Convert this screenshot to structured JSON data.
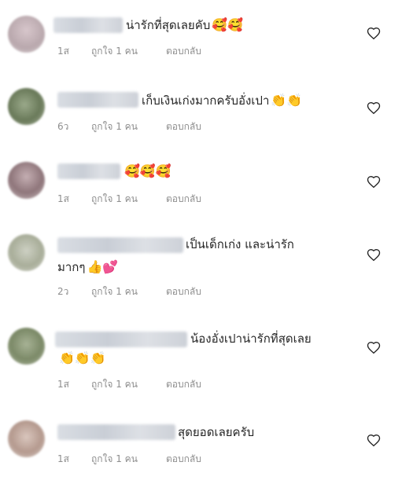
{
  "colors": {
    "text": "#262626",
    "meta": "#8e8e8e",
    "blur": "#cfd3da"
  },
  "comments": [
    {
      "text": "น่ารักที่สุดเลยคับ",
      "emoji": "🥰🥰",
      "time": "1ส",
      "likes": "ถูกใจ 1 คน",
      "reply": "ตอบกลับ",
      "avatar": "#c9b8bd"
    },
    {
      "text": "เก็บเงินเก่งมากครับอั่งเปา",
      "emoji": "👏👏",
      "time": "6ว",
      "likes": "ถูกใจ 1 คน",
      "reply": "ตอบกลับ",
      "avatar": "#7d8c6a"
    },
    {
      "text": "",
      "emoji": "🥰🥰🥰",
      "time": "1ส",
      "likes": "ถูกใจ 1 คน",
      "reply": "ตอบกลับ",
      "avatar": "#a58d91"
    },
    {
      "text": "เป็นเด็กเก่ง และน่ารัก",
      "text2": "มากๆ",
      "emoji2": "👍💕",
      "time": "2ว",
      "likes": "ถูกใจ 1 คน",
      "reply": "ตอบกลับ",
      "avatar": "#b7bcaa"
    },
    {
      "text": "น้องอั่งเปาน่ารักที่สุดเลย",
      "emoji2": "👏👏👏",
      "time": "1ส",
      "likes": "ถูกใจ 1 คน",
      "reply": "ตอบกลับ",
      "avatar": "#8e9a7c"
    },
    {
      "text": "สุดยอดเลยครับ",
      "time": "1ส",
      "likes": "ถูกใจ 1 คน",
      "reply": "ตอบกลับ",
      "avatar": "#c8b0a6"
    }
  ]
}
